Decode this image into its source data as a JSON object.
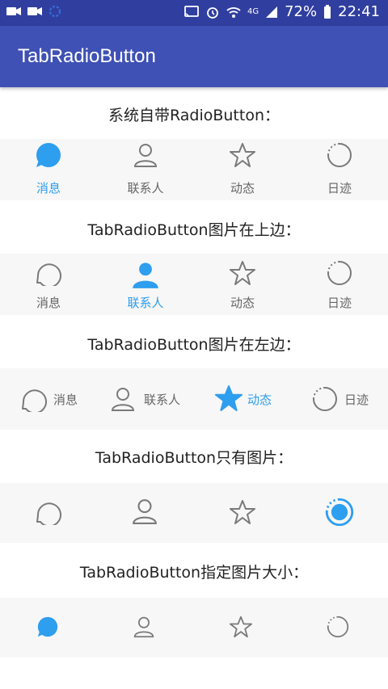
{
  "status": {
    "battery": "72%",
    "time": "22:41",
    "network": "4G"
  },
  "app": {
    "title": "TabRadioButton"
  },
  "sections": [
    {
      "title": "系统自带RadioButton：",
      "tabs": [
        {
          "label": "消息",
          "icon": "message-icon",
          "selected": true
        },
        {
          "label": "联系人",
          "icon": "contact-icon",
          "selected": false
        },
        {
          "label": "动态",
          "icon": "star-icon",
          "selected": false
        },
        {
          "label": "日迹",
          "icon": "circle-loading-icon",
          "selected": false
        }
      ]
    },
    {
      "title": "TabRadioButton图片在上边：",
      "tabs": [
        {
          "label": "消息",
          "icon": "message-icon",
          "selected": false
        },
        {
          "label": "联系人",
          "icon": "contact-icon",
          "selected": true
        },
        {
          "label": "动态",
          "icon": "star-icon",
          "selected": false
        },
        {
          "label": "日迹",
          "icon": "circle-loading-icon",
          "selected": false
        }
      ]
    },
    {
      "title": "TabRadioButton图片在左边：",
      "tabs": [
        {
          "label": "消息",
          "icon": "message-icon",
          "selected": false
        },
        {
          "label": "联系人",
          "icon": "contact-icon",
          "selected": false
        },
        {
          "label": "动态",
          "icon": "star-icon",
          "selected": true
        },
        {
          "label": "日迹",
          "icon": "circle-loading-icon",
          "selected": false
        }
      ]
    },
    {
      "title": "TabRadioButton只有图片：",
      "tabs": [
        {
          "icon": "message-icon",
          "selected": false
        },
        {
          "icon": "contact-icon",
          "selected": false
        },
        {
          "icon": "star-icon",
          "selected": false
        },
        {
          "icon": "circle-loading-icon",
          "selected": true
        }
      ]
    },
    {
      "title": "TabRadioButton指定图片大小：",
      "tabs": [
        {
          "icon": "message-icon",
          "selected": true
        },
        {
          "icon": "contact-icon",
          "selected": false
        },
        {
          "icon": "star-icon",
          "selected": false
        },
        {
          "icon": "circle-loading-icon",
          "selected": false
        }
      ]
    }
  ],
  "colors": {
    "statusbar": "#303F9F",
    "appbar": "#3F51B5",
    "selected": "#2E9EEF",
    "unselected": "#7A7A7A",
    "tabbar_bg": "#F7F7F7"
  }
}
